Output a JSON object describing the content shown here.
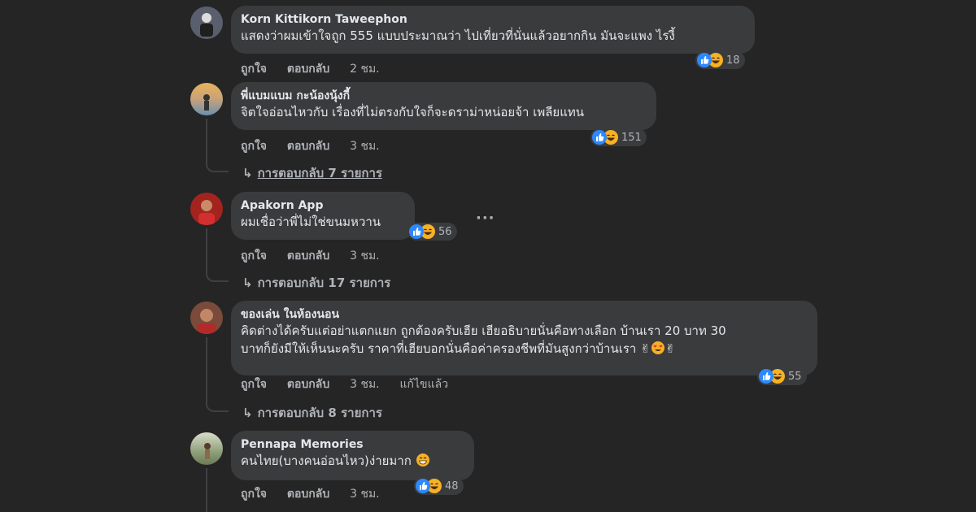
{
  "comments": [
    {
      "author": "Korn Kittikorn Taweephon",
      "text": "แสดงว่าผมเข้าใจถูก 555 แบบประมาณว่า ไปเที่ยวที่นั่นแล้วอยากกิน มันจะแพง ไรงี้",
      "like": "ถูกใจ",
      "reply": "ตอบกลับ",
      "time": "2 ชม.",
      "reactions": "18"
    },
    {
      "author": "พี่แบมแบม กะน้องนุ้งกี้",
      "text": "จิตใจอ่อนไหวกับ เรื่องที่ไม่ตรงกับใจก็จะดราม่าหน่อยจ้า เพลียแทน",
      "like": "ถูกใจ",
      "reply": "ตอบกลับ",
      "time": "3 ชม.",
      "reactions": "151",
      "replies": "การตอบกลับ 7 รายการ"
    },
    {
      "author": "Apakorn App",
      "text": "ผมเชื่อว่าพี่ไม่ใช่ขนมหวาน",
      "like": "ถูกใจ",
      "reply": "ตอบกลับ",
      "time": "3 ชม.",
      "reactions": "56",
      "replies": "การตอบกลับ 17 รายการ",
      "more": "···"
    },
    {
      "author": "ของเล่น ในห้องนอน",
      "text_line1": "คิดต่างได้ครับแต่อย่าแตกแยก ถูกต้องครับเฮีย เฮียอธิบายนั่นคือทางเลือก บ้านเรา 20 บาท 30",
      "text_line2": "บาทก็ยังมีให้เห็นนะครับ ราคาที่เฮียบอกนั่นคือค่าครองชีพที่มันสูงกว่าบ้านเรา",
      "like": "ถูกใจ",
      "reply": "ตอบกลับ",
      "time": "3 ชม.",
      "edited": "แก้ไขแล้ว",
      "reactions": "55",
      "replies": "การตอบกลับ 8 รายการ"
    },
    {
      "author": "Pennapa Memories",
      "text": "คนไทย(บางคนอ่อนไหว)ง่ายมาก",
      "like": "ถูกใจ",
      "reply": "ตอบกลับ",
      "time": "3 ชม.",
      "reactions": "48"
    }
  ],
  "colors": {
    "background": "#252525",
    "bubble": "#3a3b3c",
    "text": "#e4e6eb",
    "muted": "#b0b3b8",
    "like_blue": "#2d88ff",
    "haha_yellow": "#f7b125"
  }
}
